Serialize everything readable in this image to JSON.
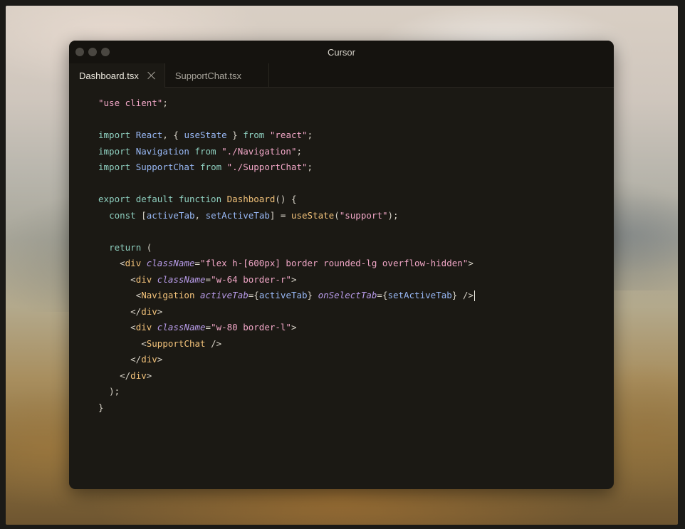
{
  "window": {
    "title": "Cursor"
  },
  "tabs": [
    {
      "label": "Dashboard.tsx",
      "active": true
    },
    {
      "label": "SupportChat.tsx",
      "active": false
    }
  ],
  "code": {
    "l1_str": "\"use client\"",
    "l1_semi": ";",
    "imp": "import",
    "from": "from",
    "l3_react": "React",
    "l3_mid": ", { ",
    "l3_usestate": "useState",
    "l3_close": " } ",
    "l3_str": "\"react\"",
    "l4_nav": "Navigation",
    "l4_str": "\"./Navigation\"",
    "l5_sc": "SupportChat",
    "l5_str": "\"./SupportChat\"",
    "l7_export": "export",
    "l7_default": "default",
    "l7_function": "function",
    "l7_name": "Dashboard",
    "l7_tail": "() {",
    "l8_const": "const",
    "l8_open": " [",
    "l8_a": "activeTab",
    "l8_comma": ", ",
    "l8_b": "setActiveTab",
    "l8_eq": "] = ",
    "l8_fn": "useState",
    "l8_str": "\"support\"",
    "l8_end": ");",
    "l10_return": "return",
    "l10_paren": " (",
    "lt": "<",
    "lts": "</",
    "gt": ">",
    "div": "div",
    "classname": "className",
    "eq": "=",
    "l11_str": "\"flex h-[600px] border rounded-lg overflow-hidden\"",
    "l12_str": "\"w-64 border-r\"",
    "l13_nav": "Navigation",
    "l13_attr1": "activeTab",
    "l13_val1_open": "{",
    "l13_val1": "activeTab",
    "l13_val1_close": "}",
    "l13_attr2": "onSelectTab",
    "l13_val2": "setActiveTab",
    "selfclose": " />",
    "l15_str": "\"w-80 border-l\"",
    "l16_sc": "SupportChat",
    "l19_end": ");",
    "l20_end": "}",
    "paren_open": "(",
    "paren_close": ")"
  }
}
